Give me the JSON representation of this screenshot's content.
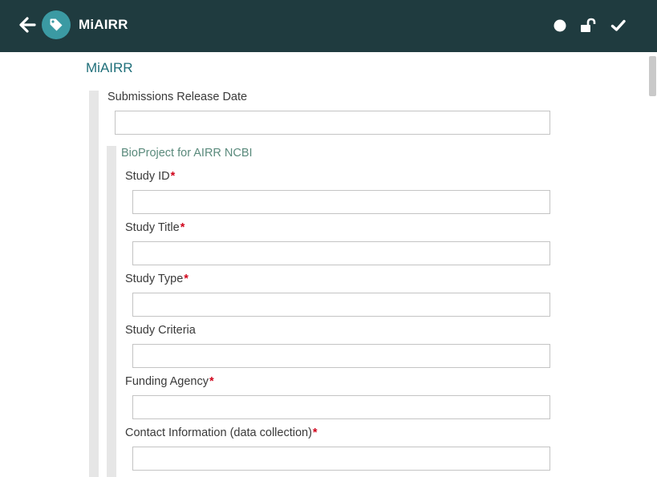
{
  "header": {
    "title": "MiAIRR",
    "icons": {
      "back": "arrow-left-icon",
      "tag": "tag-icon",
      "status": "circle-icon",
      "lock": "unlock-icon",
      "confirm": "check-icon"
    },
    "colors": {
      "bar": "#1f3b3f",
      "tag_circle": "#3b9aa3"
    }
  },
  "page": {
    "title": "MiAIRR"
  },
  "form": {
    "submissions_release_date": {
      "label": "Submissions Release Date",
      "value": "",
      "required": false
    },
    "section": {
      "title": "BioProject for AIRR NCBI",
      "fields": [
        {
          "label": "Study ID",
          "value": "",
          "required": true
        },
        {
          "label": "Study Title",
          "value": "",
          "required": true
        },
        {
          "label": "Study Type",
          "value": "",
          "required": true
        },
        {
          "label": "Study Criteria",
          "value": "",
          "required": false
        },
        {
          "label": "Funding Agency",
          "value": "",
          "required": true
        },
        {
          "label": "Contact Information (data collection)",
          "value": "",
          "required": true
        }
      ]
    },
    "required_marker": "*"
  }
}
